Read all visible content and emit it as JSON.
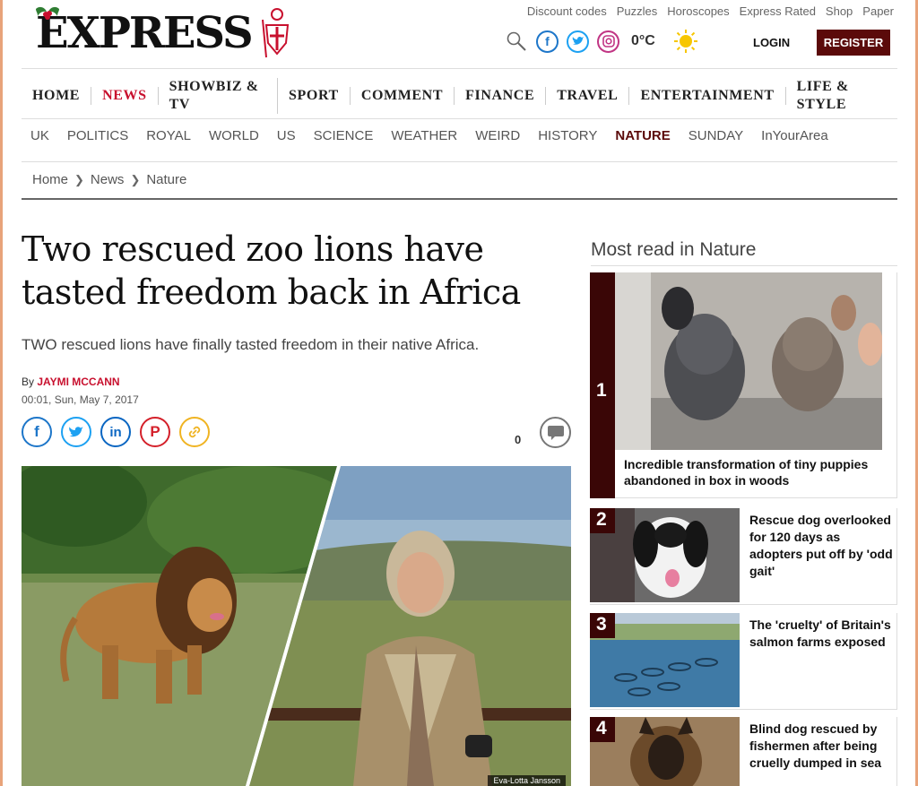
{
  "brand": {
    "name": "EXPRESS"
  },
  "util_links": [
    "Discount codes",
    "Puzzles",
    "Horoscopes",
    "Express Rated",
    "Shop",
    "Paper"
  ],
  "header": {
    "temperature": "0°C",
    "login": "LOGIN",
    "register": "REGISTER"
  },
  "nav_main": [
    "HOME",
    "NEWS",
    "SHOWBIZ & TV",
    "SPORT",
    "COMMENT",
    "FINANCE",
    "TRAVEL",
    "ENTERTAINMENT",
    "LIFE & STYLE"
  ],
  "nav_main_active": "NEWS",
  "nav_sub": [
    "UK",
    "POLITICS",
    "ROYAL",
    "WORLD",
    "US",
    "SCIENCE",
    "WEATHER",
    "WEIRD",
    "HISTORY",
    "NATURE",
    "SUNDAY",
    "InYourArea"
  ],
  "nav_sub_active": "NATURE",
  "breadcrumb": [
    "Home",
    "News",
    "Nature"
  ],
  "article": {
    "headline": "Two rescued zoo lions have tasted freedom back in Africa",
    "standfirst": "TWO rescued lions have finally tasted freedom in their native Africa.",
    "by_prefix": "By",
    "author": "JAYMI MCCANN",
    "date": "00:01, Sun, May 7, 2017",
    "comment_count": "0",
    "image_credit": "Eva-Lotta Jansson"
  },
  "most_read": {
    "title": "Most read in Nature",
    "items": [
      {
        "rank": "1",
        "title": "Incredible transformation of tiny puppies abandoned in box in woods"
      },
      {
        "rank": "2",
        "title": "Rescue dog overlooked for 120 days as adopters put off by 'odd gait'"
      },
      {
        "rank": "3",
        "title": "The 'cruelty' of Britain's salmon farms exposed"
      },
      {
        "rank": "4",
        "title": "Blind dog rescued by fishermen after being cruelly dumped in sea"
      }
    ]
  },
  "colors": {
    "accent_red": "#c8102e",
    "maroon": "#5b0a0a",
    "rank_band": "#3a0606"
  },
  "icons": [
    "holly-icon",
    "crusader-icon",
    "search-icon",
    "facebook-icon",
    "twitter-icon",
    "instagram-icon",
    "sun-icon",
    "linkedin-icon",
    "pinterest-icon",
    "link-icon",
    "comment-icon",
    "chevron-right-icon"
  ]
}
